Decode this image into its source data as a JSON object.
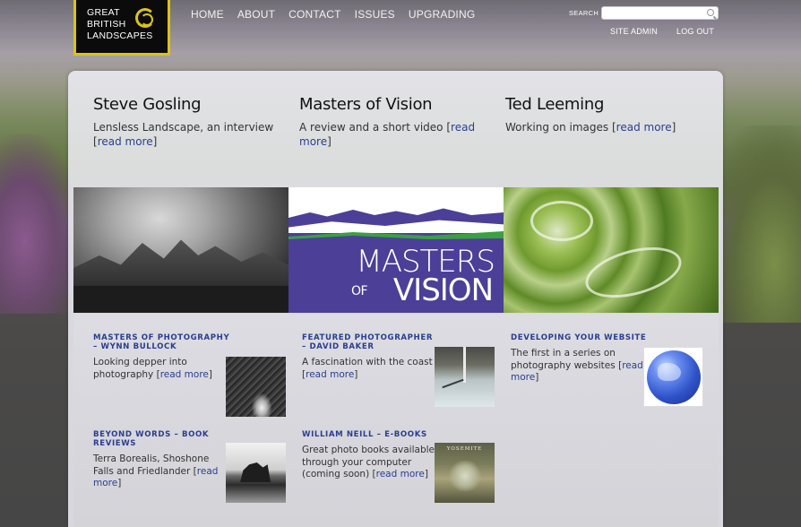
{
  "logo": {
    "lines": [
      "GREAT",
      "BRITISH",
      "LANDSCAPES"
    ]
  },
  "nav": {
    "items": [
      "HOME",
      "ABOUT",
      "CONTACT",
      "ISSUES",
      "UPGRADING"
    ]
  },
  "search": {
    "label": "SEARCH",
    "value": "",
    "placeholder": ""
  },
  "admin": {
    "site_admin": "SITE ADMIN",
    "log_out": "LOG OUT"
  },
  "features": [
    {
      "title": "Steve Gosling",
      "text": "Lensless Landscape, an interview",
      "link": "read more"
    },
    {
      "title": "Masters of Vision",
      "text": "A review and a short video",
      "link": "read more"
    },
    {
      "title": "Ted Leeming",
      "text": "Working on images",
      "link": "read more"
    }
  ],
  "banners": {
    "masters_word1": "MASTERS",
    "masters_of": "OF",
    "masters_word2": "VISION"
  },
  "cards": [
    {
      "title": "MASTERS OF PHOTOGRAPHY – WYNN BULLOCK",
      "text": "Looking depper into photography",
      "link": "read more",
      "thumb_icon": "photo-bullock"
    },
    {
      "title": "FEATURED PHOTOGRAPHER – DAVID BAKER",
      "text": "A fascination with the coast",
      "link": "read more",
      "thumb_icon": "photo-baker"
    },
    {
      "title": "DEVELOPING YOUR WEBSITE",
      "text": "The first in a series on photography websites",
      "link": "read more",
      "thumb_icon": "globe-icon"
    },
    {
      "title": "BEYOND WORDS – BOOK REVIEWS",
      "text": "Terra Borealis, Shoshone Falls and Friedlander",
      "link": "read more",
      "thumb_icon": "photo-rock"
    },
    {
      "title": "WILLIAM NEILL – E-BOOKS",
      "text": "Great photo books available through your computer (coming soon)",
      "link": "read more",
      "thumb_icon": "book-yosemite",
      "thumb_text": "YOSEMITE"
    }
  ],
  "colors": {
    "logo_border": "#d9c31a",
    "link": "#2b3e8f",
    "masters_bg": "#4b3f98"
  }
}
